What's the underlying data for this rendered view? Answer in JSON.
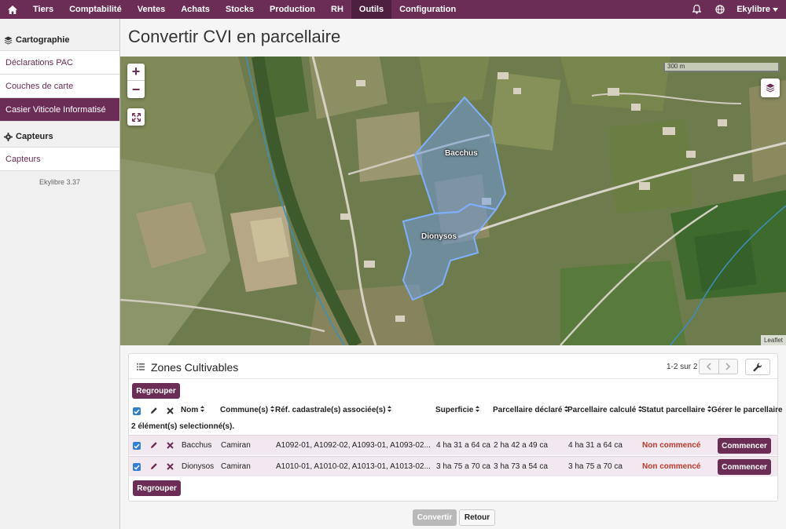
{
  "topnav": {
    "items": [
      "Tiers",
      "Comptabilité",
      "Ventes",
      "Achats",
      "Stocks",
      "Production",
      "RH",
      "Outils",
      "Configuration"
    ],
    "active": "Outils",
    "user": "Ekylibre",
    "icons": [
      "home-icon",
      "bell-icon",
      "globe-icon",
      "caret-down-icon"
    ]
  },
  "sidebar": {
    "group1": {
      "title": "Cartographie",
      "items": [
        "Déclarations PAC",
        "Couches de carte",
        "Casier Viticole Informatisé"
      ],
      "active": "Casier Viticole Informatisé"
    },
    "group2": {
      "title": "Capteurs",
      "items": [
        "Capteurs"
      ]
    },
    "version": "Ekylibre 3.37"
  },
  "page": {
    "title": "Convertir CVI en parcellaire"
  },
  "map": {
    "scale_label": "300 m",
    "attribution": "Leaflet",
    "zoom_in": "+",
    "zoom_out": "−",
    "parcels": [
      "Bacchus",
      "Dionysos"
    ],
    "parcel_color": "#6f9ee8"
  },
  "panel": {
    "title": "Zones Cultivables",
    "pagination": "1-2 sur 2",
    "regroup_label": "Regrouper",
    "selected_info": "2 élément(s) selectionné(s).",
    "columns": [
      "Nom",
      "Commune(s)",
      "Réf. cadastrale(s) associée(s)",
      "Superficie",
      "Parcellaire déclaré",
      "Parcellaire calculé",
      "Statut parcellaire",
      "Gérer le parcellaire"
    ],
    "rows": [
      {
        "nom": "Bacchus",
        "commune": "Camiran",
        "refs": "A1092-01, A1092-02, A1093-01, A1093-02...",
        "superficie": "4 ha 31 a 64 ca",
        "declare": "2 ha 42 a 49 ca",
        "calcule": "4 ha 31 a 64 ca",
        "statut": "Non commencé",
        "action": "Commencer"
      },
      {
        "nom": "Dionysos",
        "commune": "Camiran",
        "refs": "A1010-01, A1010-02, A1013-01, A1013-02...",
        "superficie": "3 ha 75 a 70 ca",
        "declare": "3 ha 73 a 54 ca",
        "calcule": "3 ha 75 a 70 ca",
        "statut": "Non commencé",
        "action": "Commencer"
      }
    ]
  },
  "footer": {
    "convert_label": "Convertir",
    "back_label": "Retour"
  },
  "colors": {
    "brand": "#6b2d55",
    "status": "#c0392b",
    "checkbox": "#2f7fd8"
  }
}
